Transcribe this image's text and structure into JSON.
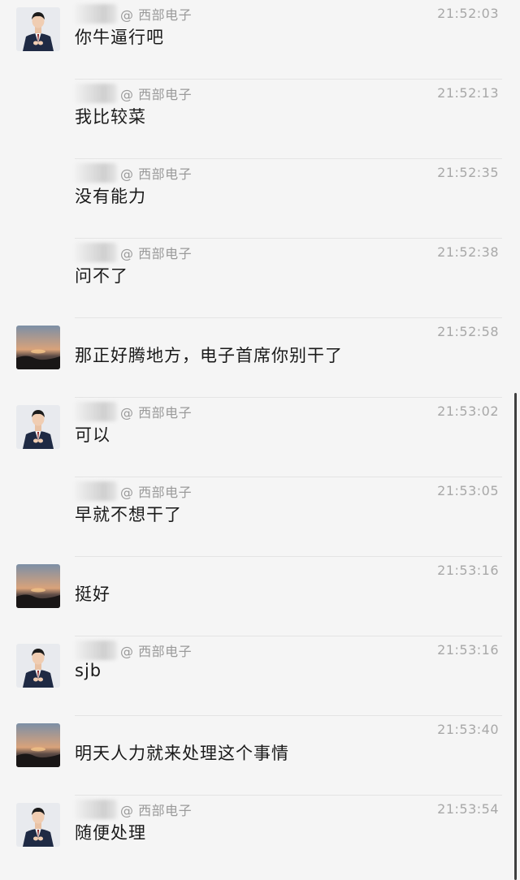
{
  "messages": [
    {
      "avatar": "man-in-suit-avatar",
      "mention": "@ 西部电子",
      "time": "21:52:03",
      "text": "你牛逼行吧"
    },
    {
      "avatar": "",
      "mention": "@ 西部电子",
      "time": "21:52:13",
      "text": "我比较菜"
    },
    {
      "avatar": "",
      "mention": "@ 西部电子",
      "time": "21:52:35",
      "text": "没有能力"
    },
    {
      "avatar": "",
      "mention": "@ 西部电子",
      "time": "21:52:38",
      "text": "问不了"
    },
    {
      "avatar": "sunset-avatar",
      "mention": "",
      "time": "21:52:58",
      "text": "那正好腾地方，电子首席你别干了"
    },
    {
      "avatar": "man-in-suit-avatar",
      "mention": "@ 西部电子",
      "time": "21:53:02",
      "text": "可以"
    },
    {
      "avatar": "",
      "mention": "@ 西部电子",
      "time": "21:53:05",
      "text": "早就不想干了"
    },
    {
      "avatar": "sunset-avatar",
      "mention": "",
      "time": "21:53:16",
      "text": "挺好"
    },
    {
      "avatar": "man-in-suit-avatar",
      "mention": "@ 西部电子",
      "time": "21:53:16",
      "text": "sjb"
    },
    {
      "avatar": "sunset-avatar",
      "mention": "",
      "time": "21:53:40",
      "text": "明天人力就来处理这个事情"
    },
    {
      "avatar": "man-in-suit-avatar",
      "mention": "@ 西部电子",
      "time": "21:53:54",
      "text": "随便处理"
    }
  ],
  "colors": {
    "background": "#f5f5f5",
    "text": "#1a1a1a",
    "meta": "#a8a8a8",
    "divider": "#e4e4e4"
  }
}
